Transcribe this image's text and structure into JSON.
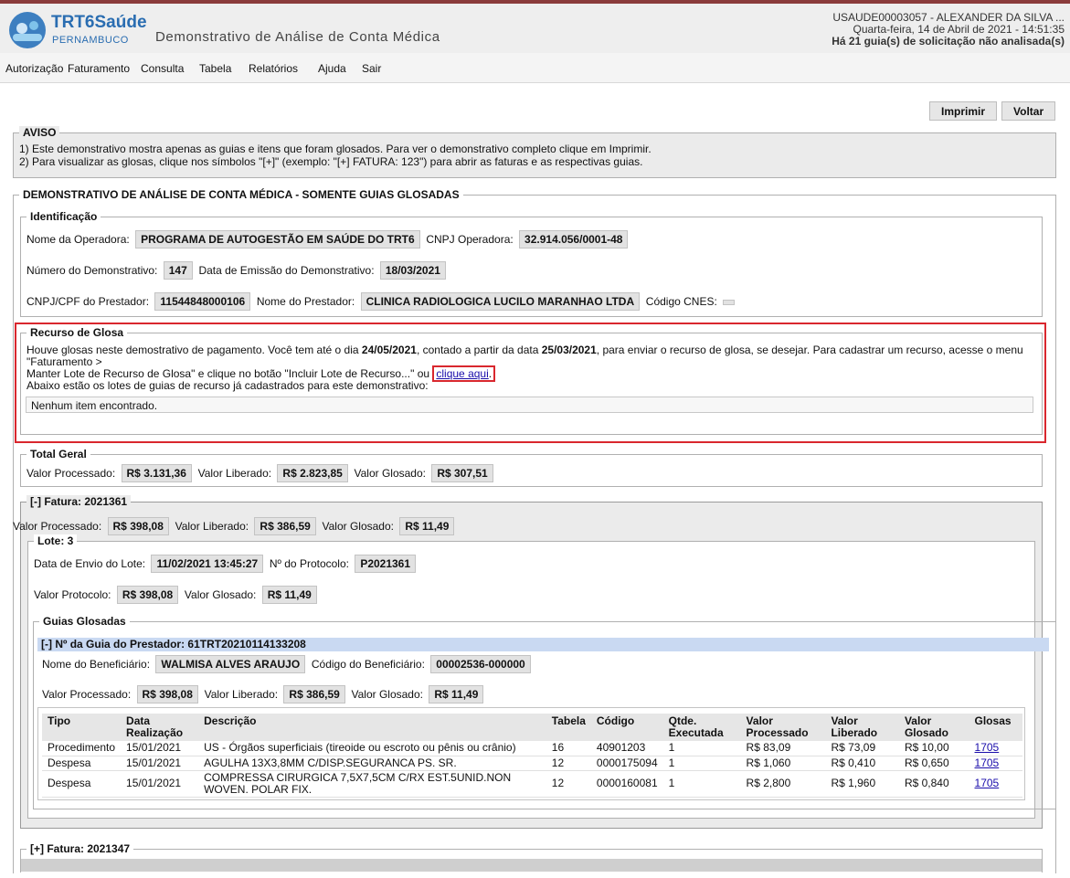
{
  "header": {
    "logo_title": "TRT6Saúde",
    "logo_sub": "PERNAMBUCO",
    "app_title": "Demonstrativo de Análise de Conta Médica",
    "user": "USAUDE00003057 - ALEXANDER DA SILVA ...",
    "datetime": "Quarta-feira, 14 de Abril de 2021 - 14:51:35",
    "pending": "Há 21 guia(s) de solicitação não analisada(s)"
  },
  "menu": [
    "Autorização",
    "Faturamento",
    "Consulta",
    "Tabela",
    "Relatórios",
    "Ajuda",
    "Sair"
  ],
  "buttons": {
    "print": "Imprimir",
    "back": "Voltar"
  },
  "aviso": {
    "legend": "AVISO",
    "line1": "1) Este demonstrativo mostra apenas as guias e itens que foram glosados. Para ver o demonstrativo completo clique em Imprimir.",
    "line2": "2) Para visualizar as glosas, clique nos símbolos \"[+]\" (exemplo: \"[+] FATURA: 123\") para abrir as faturas e as respectivas guias."
  },
  "demo": {
    "legend": "DEMONSTRATIVO DE ANÁLISE DE CONTA MÉDICA - SOMENTE GUIAS GLOSADAS",
    "ident": {
      "legend": "Identificação",
      "operadora_label": "Nome da Operadora:",
      "operadora": "PROGRAMA DE AUTOGESTÃO EM SAÚDE DO TRT6",
      "cnpj_op_label": "CNPJ Operadora:",
      "cnpj_op": "32.914.056/0001-48",
      "numero_label": "Número do Demonstrativo:",
      "numero": "147",
      "emissao_label": "Data de Emissão do Demonstrativo:",
      "emissao": "18/03/2021",
      "cnpj_prest_label": "CNPJ/CPF do Prestador:",
      "cnpj_prest": "11544848000106",
      "prestador_label": "Nome do Prestador:",
      "prestador": "CLINICA RADIOLOGICA LUCILO MARANHAO LTDA",
      "cnes_label": "Código CNES:",
      "cnes": ""
    },
    "recurso": {
      "legend": "Recurso de Glosa",
      "t1": "Houve glosas neste demostrativo de pagamento. Você tem até o dia ",
      "date1": "24/05/2021",
      "t2": ", contado a partir da data ",
      "date2": "25/03/2021",
      "t3": ", para enviar o recurso de glosa, se desejar. Para cadastrar um recurso, acesse o menu \"Faturamento >",
      "t4": "Manter Lote de Recurso de Glosa\" e clique no botão \"Incluir Lote de Recurso...\" ou ",
      "link": "clique aqui",
      "t5": ".",
      "lotes_text": "Abaixo estão os lotes de guias de recurso já cadastrados para este demonstrativo:",
      "empty": "Nenhum item encontrado."
    },
    "total": {
      "legend": "Total Geral",
      "proc_label": "Valor Processado:",
      "proc": "R$ 3.131,36",
      "lib_label": "Valor Liberado:",
      "lib": "R$ 2.823,85",
      "glos_label": "Valor Glosado:",
      "glos": "R$ 307,51"
    },
    "fatura": {
      "legend": "[-] Fatura: 2021361",
      "proc_label": "Valor Processado:",
      "proc": "R$ 398,08",
      "lib_label": "Valor Liberado:",
      "lib": "R$ 386,59",
      "glos_label": "Valor Glosado:",
      "glos": "R$ 11,49",
      "lote": {
        "legend": "Lote: 3",
        "envio_label": "Data de Envio do Lote:",
        "envio": "11/02/2021 13:45:27",
        "protocolo_label": "Nº do Protocolo:",
        "protocolo": "P2021361",
        "vprot_label": "Valor Protocolo:",
        "vprot": "R$ 398,08",
        "vglos_label": "Valor Glosado:",
        "vglos": "R$ 11,49"
      },
      "guias": {
        "legend": "Guias Glosadas",
        "header": "[-] Nº da Guia do Prestador: 61TRT20210114133208",
        "benef_label": "Nome do Beneficiário:",
        "benef": "WALMISA ALVES ARAUJO",
        "cod_label": "Código do Beneficiário:",
        "cod": "00002536-000000",
        "proc_label": "Valor Processado:",
        "proc": "R$ 398,08",
        "lib_label": "Valor Liberado:",
        "lib": "R$ 386,59",
        "glos_label": "Valor Glosado:",
        "glos": "R$ 11,49"
      }
    },
    "fatura2": {
      "legend": "[+] Fatura: 2021347"
    }
  },
  "table": {
    "headers": [
      "Tipo",
      "Data Realização",
      "Descrição",
      "Tabela",
      "Código",
      "Qtde. Executada",
      "Valor Processado",
      "Valor Liberado",
      "Valor Glosado",
      "Glosas"
    ],
    "rows": [
      [
        "Procedimento",
        "15/01/2021",
        "US - Órgãos superficiais (tireoide ou escroto ou pênis ou crânio)",
        "16",
        "40901203",
        "1",
        "R$ 83,09",
        "R$ 73,09",
        "R$ 10,00",
        "1705"
      ],
      [
        "Despesa",
        "15/01/2021",
        "AGULHA 13X3,8MM C/DISP.SEGURANCA PS. SR.",
        "12",
        "0000175094",
        "1",
        "R$ 1,060",
        "R$ 0,410",
        "R$ 0,650",
        "1705"
      ],
      [
        "Despesa",
        "15/01/2021",
        "COMPRESSA CIRURGICA 7,5X7,5CM C/RX EST.5UNID.NON WOVEN. POLAR FIX.",
        "12",
        "0000160081",
        "1",
        "R$ 2,800",
        "R$ 1,960",
        "R$ 0,840",
        "1705"
      ]
    ]
  }
}
